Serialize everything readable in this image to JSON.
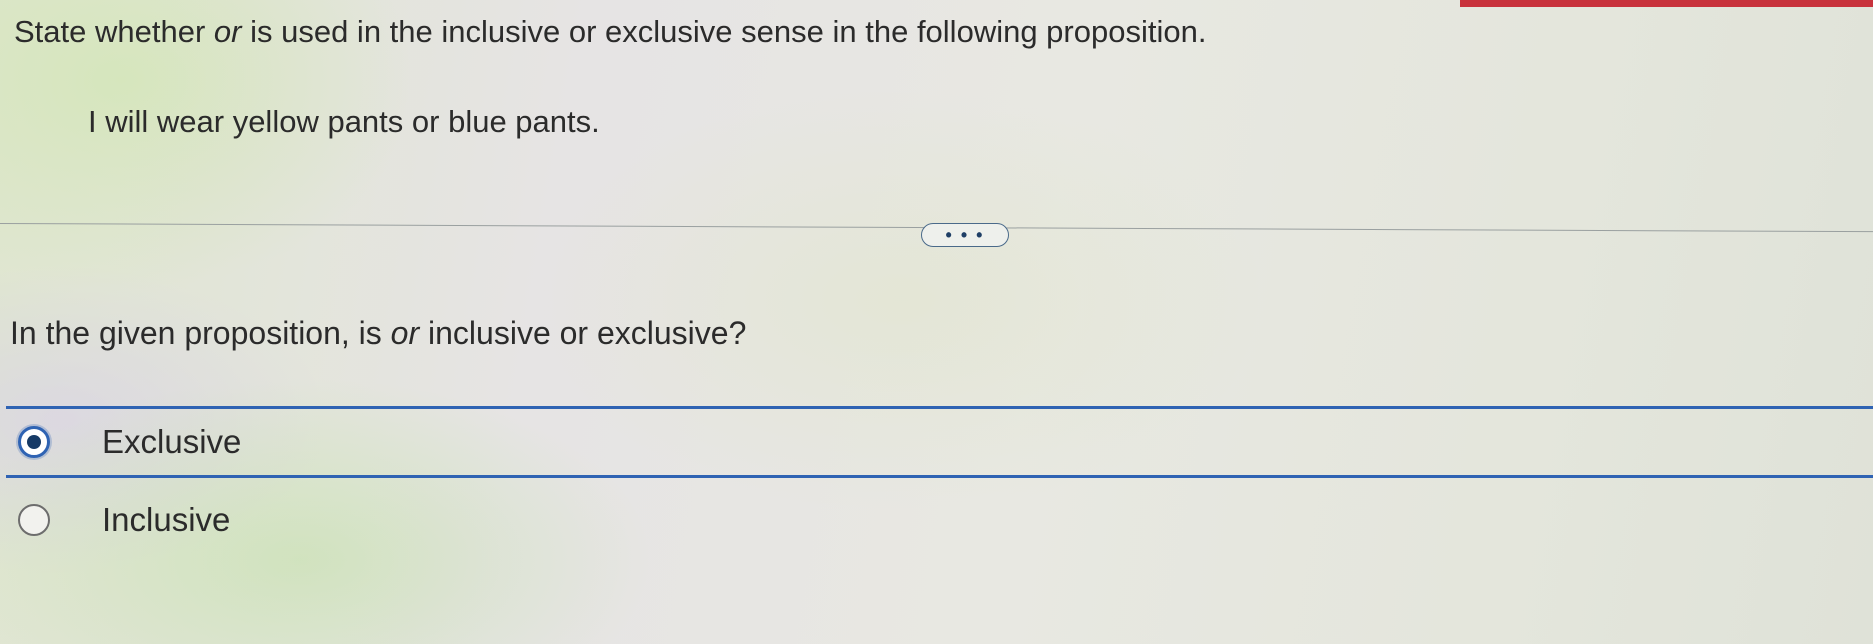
{
  "header": {
    "accent_color": "#c8323c"
  },
  "prompt": {
    "before": "State whether ",
    "keyword": "or",
    "after": " is used in the inclusive or exclusive sense in the following proposition."
  },
  "proposition": "I will wear yellow pants or blue pants.",
  "more_button": {
    "label": "• • •",
    "icon": "ellipsis-icon"
  },
  "question": {
    "before": "In the given proposition, is ",
    "keyword": "or",
    "after": " inclusive or exclusive?"
  },
  "options": [
    {
      "label": "Exclusive",
      "selected": true
    },
    {
      "label": "Inclusive",
      "selected": false
    }
  ],
  "colors": {
    "selection": "#2f63b3",
    "text": "#2b2b2b"
  }
}
